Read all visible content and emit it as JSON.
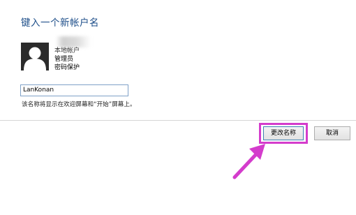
{
  "dialog": {
    "heading": "键入一个新帐户名",
    "account": {
      "type_label": "本地帐户",
      "role_label": "管理员",
      "protection_label": "密码保护"
    },
    "name_input": {
      "value": "LanKonan"
    },
    "hint": "该名称将显示在欢迎屏幕和“开始”屏幕上。",
    "buttons": {
      "rename_label": "更改名称",
      "cancel_label": "取消"
    }
  },
  "annotation": {
    "color": "#d43ccc",
    "highlight_target": "rename-button"
  },
  "colors": {
    "heading": "#1d4e89",
    "avatar": "#2b2b2b",
    "input_border": "#7fa1c8"
  }
}
